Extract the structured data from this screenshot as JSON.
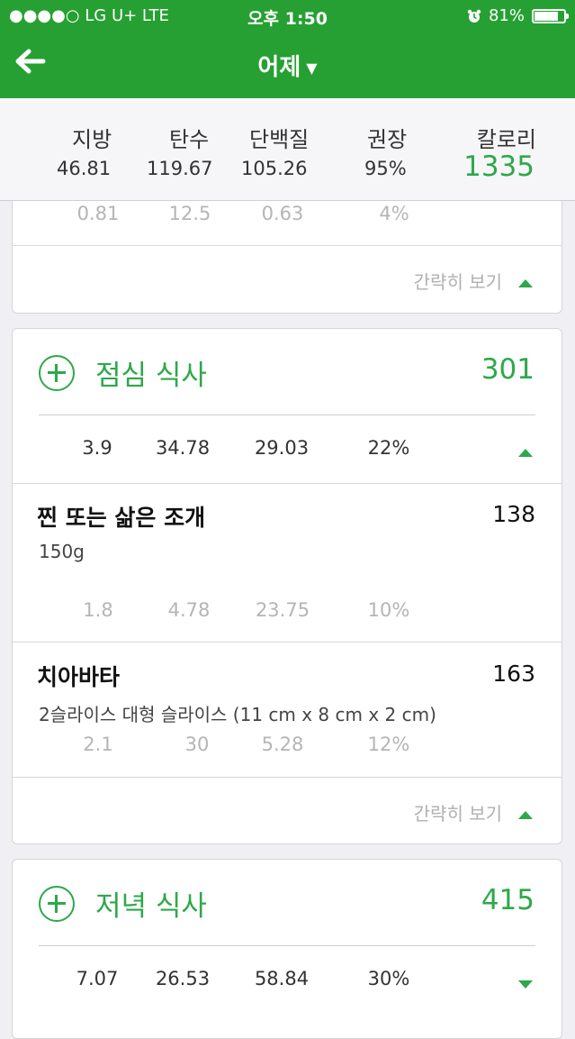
{
  "status_bar": {
    "carrier": "●●●●○ LG U+   LTE",
    "time": "오후 1:50",
    "alarm_icon": "alarm-clock-icon",
    "battery": "81%",
    "battery_level": 0.81
  },
  "nav": {
    "back_icon": "arrow-left-icon",
    "title": "어제",
    "caret_icon": "caret-down-icon"
  },
  "summary": {
    "fat_label": "지방",
    "fat": "46.81",
    "carbs_label": "탄수",
    "carbs": "119.67",
    "protein_label": "단백질",
    "protein": "105.26",
    "rec_label": "권장",
    "rec": "95%",
    "cal_label": "칼로리",
    "cal": "1335"
  },
  "prev_card": {
    "fat": "0.81",
    "carbs": "12.5",
    "protein": "0.63",
    "rec": "4%",
    "collapse_label": "간략히 보기"
  },
  "lunch": {
    "title": "점심 식사",
    "calories": "301",
    "fat": "3.9",
    "carbs": "34.78",
    "protein": "29.03",
    "rec": "22%",
    "items": [
      {
        "name": "찐 또는 삶은 조개",
        "calories": "138",
        "serving": "150g",
        "fat": "1.8",
        "carbs": "4.78",
        "protein": "23.75",
        "rec": "10%"
      },
      {
        "name": "치아바타",
        "calories": "163",
        "serving": "2슬라이스 대형 슬라이스 (11 cm x 8 cm x 2 cm)",
        "fat": "2.1",
        "carbs": "30",
        "protein": "5.28",
        "rec": "12%"
      }
    ],
    "collapse_label": "간략히 보기"
  },
  "dinner": {
    "title": "저녁 식사",
    "calories": "415",
    "fat": "7.07",
    "carbs": "26.53",
    "protein": "58.84",
    "rec": "30%"
  },
  "colors": {
    "brand_green": "#26a032",
    "accent_green": "#2ea84a"
  }
}
